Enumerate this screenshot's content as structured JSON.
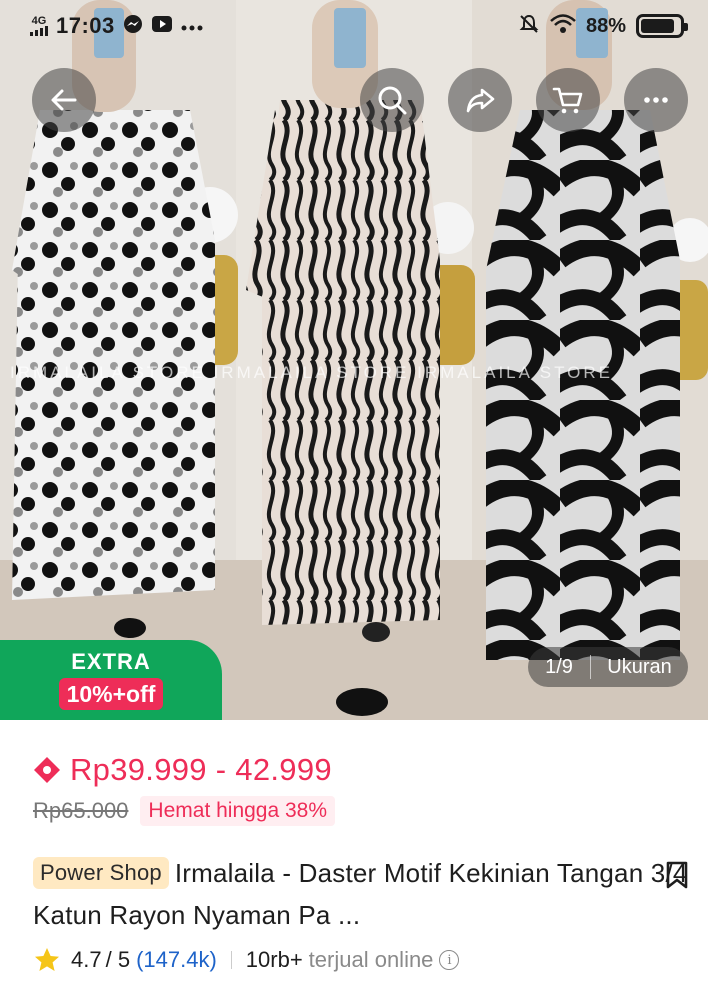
{
  "status_bar": {
    "network": "4G",
    "time": "17:03",
    "battery": "88%",
    "battery_level": 0.88,
    "icons": [
      "messenger-icon",
      "youtube-icon",
      "more-dots-icon",
      "mute-icon",
      "wifi-icon",
      "battery-icon"
    ]
  },
  "nav": {
    "back_icon": "arrow-left-icon",
    "search_icon": "search-icon",
    "share_icon": "share-icon",
    "cart_icon": "cart-icon",
    "more_icon": "more-icon"
  },
  "gallery": {
    "watermark": "IRMALAILA STORE IRMALAILA STORE IRMALAILA STORE",
    "extra_label": "EXTRA",
    "extra_discount": "10%+off",
    "pager": "1/9",
    "size_label": "Ukuran"
  },
  "product": {
    "price_range": "Rp39.999 - 42.999",
    "original_price": "Rp65.000",
    "savings": "Hemat hingga 38%",
    "shop_badge": "Power Shop",
    "title": "Irmalaila - Daster Motif Kekinian Tangan 3/4 Katun Rayon Nyaman Pa ...",
    "rating": "4.7",
    "rating_max": "/ 5",
    "rating_count": "(147.4k)",
    "sold": "10rb+",
    "sold_label": "terjual online",
    "info_icon": "i"
  },
  "colors": {
    "accent_price": "#ee2d58",
    "extra_green": "#10a65a",
    "power_shop_bg": "#ffe9c2",
    "link_blue": "#1e63c9",
    "star": "#f5c518"
  }
}
